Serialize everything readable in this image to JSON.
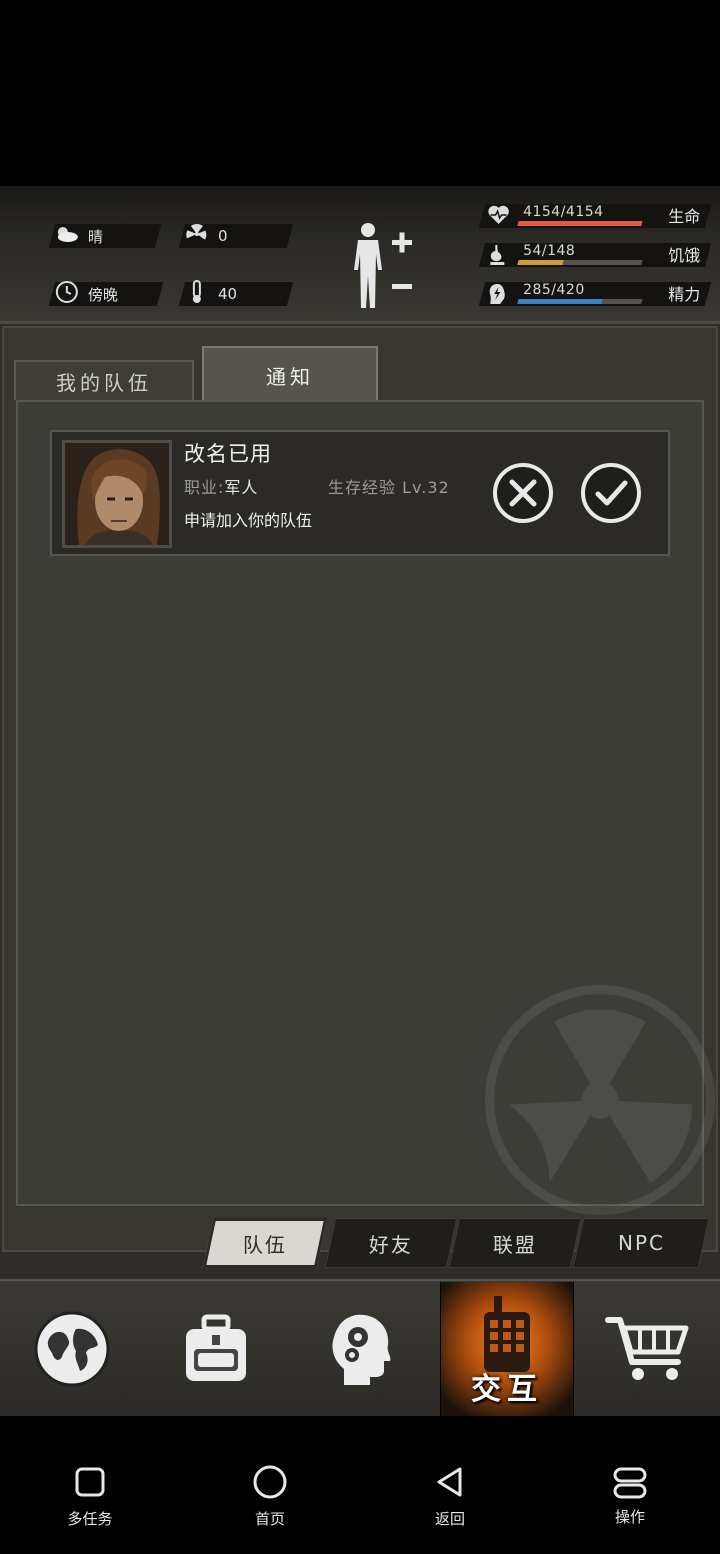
{
  "hud": {
    "weather_label": "晴",
    "radiation_value": "0",
    "time_label": "傍晚",
    "temperature_value": "40",
    "stats": [
      {
        "name": "生命",
        "value": "4154/4154",
        "fraction": 1.0,
        "color": "#e05a44",
        "icon": "heart-icon"
      },
      {
        "name": "饥饿",
        "value": "54/148",
        "fraction": 0.36,
        "color": "#d29a3a",
        "icon": "stomach-icon"
      },
      {
        "name": "精力",
        "value": "285/420",
        "fraction": 0.68,
        "color": "#3d7fc2",
        "icon": "energy-icon"
      }
    ]
  },
  "tabs": {
    "my_team": "我的队伍",
    "notice": "通知"
  },
  "notification": {
    "player_name": "改名已用",
    "job_label": "职业:",
    "job_value": "军人",
    "exp_label": "生存经验",
    "level": "Lv.32",
    "request_text": "申请加入你的队伍"
  },
  "subtabs": [
    "队伍",
    "好友",
    "联盟",
    "NPC"
  ],
  "game_nav": {
    "active_label": "交互"
  },
  "system_nav": {
    "multitask": "多任务",
    "home": "首页",
    "back": "返回",
    "operate": "操作"
  }
}
